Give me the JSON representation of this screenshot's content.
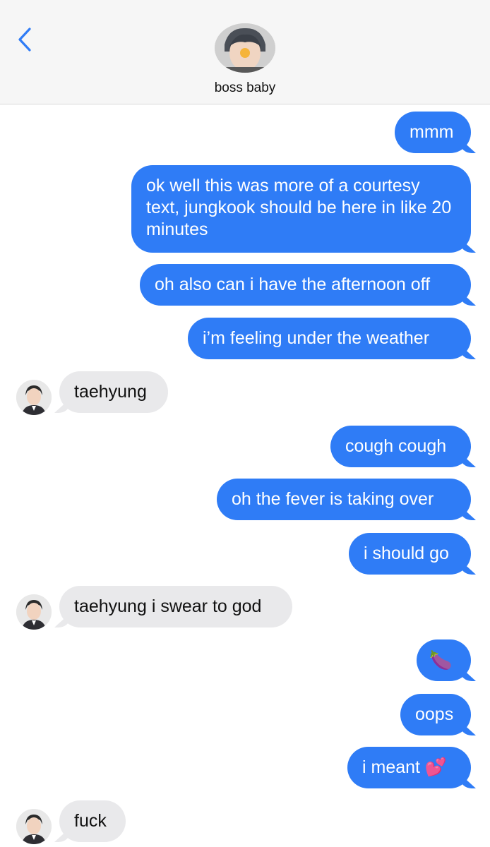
{
  "header": {
    "contact_name": "boss baby",
    "back_icon": "chevron-left-icon",
    "avatar_icon": "contact-avatar-icon",
    "accent_color": "#2f7cf6"
  },
  "messages": [
    {
      "side": "sent",
      "text": "mmm"
    },
    {
      "side": "sent",
      "text": "ok well this was more of a courtesy text, jungkook should be here in like 20 minutes"
    },
    {
      "side": "sent",
      "text": "oh also can i have the afternoon off"
    },
    {
      "side": "sent",
      "text": "i’m feeling under the weather"
    },
    {
      "side": "received",
      "text": "taehyung"
    },
    {
      "side": "sent",
      "text": "cough cough"
    },
    {
      "side": "sent",
      "text": "oh the fever is taking over"
    },
    {
      "side": "sent",
      "text": "i should go"
    },
    {
      "side": "received",
      "text": "taehyung i swear to god"
    },
    {
      "side": "sent",
      "text": "🍆"
    },
    {
      "side": "sent",
      "text": "oops"
    },
    {
      "side": "sent",
      "text": "i meant 💕"
    },
    {
      "side": "received",
      "text": "fuck"
    }
  ],
  "colors": {
    "sent_bubble": "#2f7cf6",
    "received_bubble": "#e9e9eb",
    "header_bg": "#f6f6f6"
  }
}
